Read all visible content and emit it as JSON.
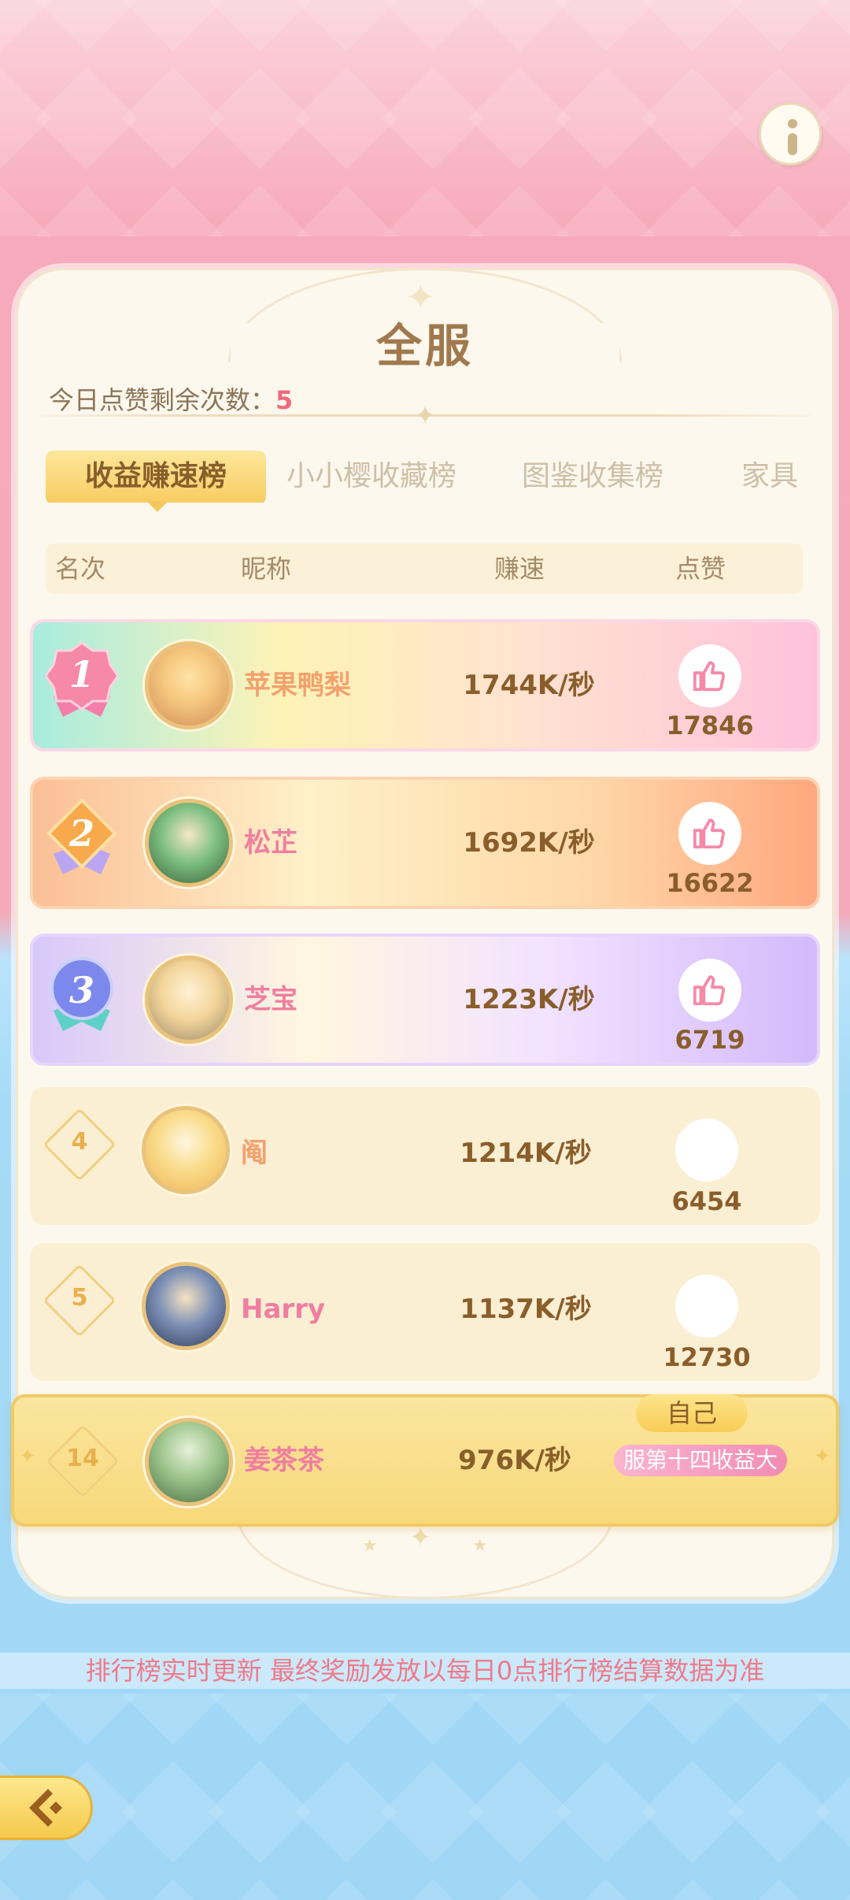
{
  "header": {
    "title": "全服"
  },
  "likes": {
    "label": "今日点赞剩余次数：",
    "value": "5"
  },
  "tabs": [
    {
      "label": "收益赚速榜",
      "active": true
    },
    {
      "label": "小小樱收藏榜",
      "active": false
    },
    {
      "label": "图鉴收集榜",
      "active": false
    },
    {
      "label": "家具",
      "active": false
    }
  ],
  "table": {
    "headers": {
      "rank": "名次",
      "name": "昵称",
      "speed": "赚速",
      "like": "点赞"
    },
    "rows": [
      {
        "rank": "1",
        "name": "苹果鸭梨",
        "speed": "1744K/秒",
        "likes": "17846"
      },
      {
        "rank": "2",
        "name": "松芷",
        "speed": "1692K/秒",
        "likes": "16622"
      },
      {
        "rank": "3",
        "name": "芝宝",
        "speed": "1223K/秒",
        "likes": "6719"
      },
      {
        "rank": "4",
        "name": "阄",
        "speed": "1214K/秒",
        "likes": "6454"
      },
      {
        "rank": "5",
        "name": "Harry",
        "speed": "1137K/秒",
        "likes": "12730"
      }
    ],
    "self": {
      "rank": "14",
      "name": "姜茶茶",
      "speed": "976K/秒",
      "badge": "自己",
      "title": "服第十四收益大"
    }
  },
  "footer": {
    "notice": "排行榜实时更新 最终奖励发放以每日0点排行榜结算数据为准"
  },
  "colors": {
    "accent_gold": "#f8cd62",
    "text_brown": "#8a5e2b",
    "pink": "#f07a8a"
  },
  "icons": [
    "info-icon",
    "thumbs-up-icon",
    "back-arrow-icon"
  ]
}
